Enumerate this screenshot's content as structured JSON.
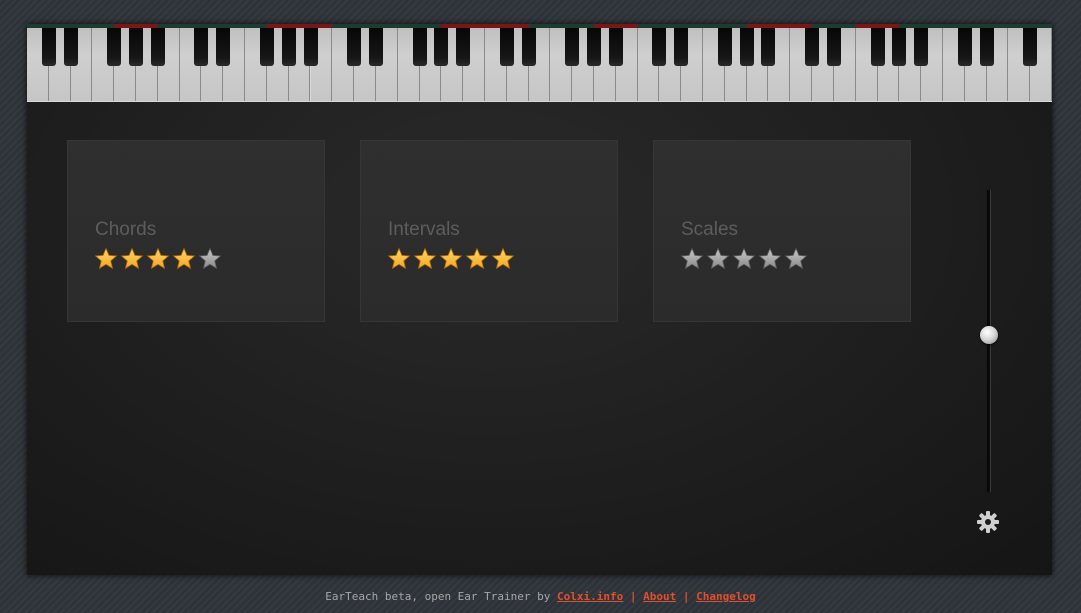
{
  "keyboard": {
    "white_key_count": 47,
    "black_key_offsets": [
      1,
      2,
      4,
      5,
      6
    ],
    "indicator_colors": {
      "idle": "#1d3b2e",
      "active": "#7a1616"
    },
    "active_indicators": [
      4,
      5,
      11,
      12,
      13,
      19,
      20,
      21,
      22,
      26,
      27,
      33,
      34,
      35,
      38,
      39
    ]
  },
  "exercises": [
    {
      "title": "Chords",
      "rating": 4,
      "max_rating": 5
    },
    {
      "title": "Intervals",
      "rating": 5,
      "max_rating": 5
    },
    {
      "title": "Scales",
      "rating": 0,
      "max_rating": 5
    }
  ],
  "volume": {
    "level": 0.52
  },
  "settings": {
    "icon": "gear-icon"
  },
  "footer": {
    "prefix": "EarTeach beta, open Ear Trainer by ",
    "links": [
      "Colxi.info",
      "About",
      "Changelog"
    ],
    "separator": "|"
  },
  "colors": {
    "star_active": "#f5a623",
    "star_inactive": "#8a8a8a",
    "link": "#e0502e",
    "background": "#2e3339"
  }
}
